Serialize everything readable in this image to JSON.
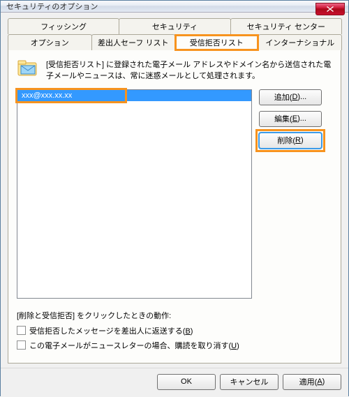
{
  "window": {
    "title": "セキュリティのオプション"
  },
  "tabs": {
    "row1": [
      "フィッシング",
      "セキュリティ",
      "セキュリティ センター"
    ],
    "row2": [
      "オプション",
      "差出人セーフ リスト",
      "受信拒否リスト",
      "インターナショナル"
    ],
    "active": "受信拒否リスト"
  },
  "desc": "[受信拒否リスト] に登録された電子メール アドレスやドメイン名から送信された電子メールやニュースは、常に迷惑メールとして処理されます。",
  "list": {
    "items": [
      "xxx@xxx.xx.xx"
    ],
    "selected_index": 0
  },
  "buttons": {
    "add": {
      "label": "追加(",
      "accel": "D",
      "suffix": ")..."
    },
    "edit": {
      "label": "編集(",
      "accel": "E",
      "suffix": ")..."
    },
    "remove": {
      "label": "削除(",
      "accel": "R",
      "suffix": ")"
    }
  },
  "options": {
    "label": "[削除と受信拒否] をクリックしたときの動作:",
    "opt1": {
      "text": "受信拒否したメッセージを差出人に返送する(",
      "accel": "B",
      "suffix": ")",
      "checked": false
    },
    "opt2": {
      "text": "この電子メールがニュースレターの場合、購読を取り消す(",
      "accel": "U",
      "suffix": ")",
      "checked": false
    }
  },
  "dialog_buttons": {
    "ok": "OK",
    "cancel": "キャンセル",
    "apply": {
      "label": "適用(",
      "accel": "A",
      "suffix": ")"
    }
  }
}
